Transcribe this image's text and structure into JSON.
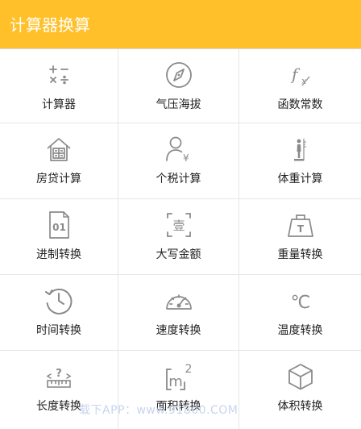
{
  "colors": {
    "accent": "#ffc02a",
    "icon": "#8a8a8a",
    "divider": "#e6e6e6",
    "text": "#222222",
    "watermark": "#c9d4ee"
  },
  "app_bar": {
    "title": "计算器换算"
  },
  "grid": {
    "items": [
      {
        "label": "计算器",
        "icon": "calculator-ops-icon"
      },
      {
        "label": "气压海拔",
        "icon": "compass-icon"
      },
      {
        "label": "函数常数",
        "icon": "function-icon"
      },
      {
        "label": "房贷计算",
        "icon": "house-icon"
      },
      {
        "label": "个税计算",
        "icon": "person-yuan-icon"
      },
      {
        "label": "体重计算",
        "icon": "scale-person-icon"
      },
      {
        "label": "进制转换",
        "icon": "binary-file-icon"
      },
      {
        "label": "大写金额",
        "icon": "uppercase-amount-icon"
      },
      {
        "label": "重量转换",
        "icon": "weight-icon"
      },
      {
        "label": "时间转换",
        "icon": "history-clock-icon"
      },
      {
        "label": "速度转换",
        "icon": "speedometer-icon"
      },
      {
        "label": "温度转换",
        "icon": "celsius-icon"
      },
      {
        "label": "长度转换",
        "icon": "ruler-icon"
      },
      {
        "label": "面积转换",
        "icon": "square-meter-icon"
      },
      {
        "label": "体积转换",
        "icon": "cube-icon"
      }
    ]
  },
  "watermark": {
    "text": "载下APP：www.91800.COM"
  },
  "icon_text": {
    "function_f": "f",
    "function_x": "x",
    "yuan": "¥",
    "uppercase_char": "壹",
    "weight_t": "T",
    "file_code": "01",
    "celsius": "℃",
    "ruler_mark": "?",
    "area_m": "m",
    "area_exp": "2"
  }
}
